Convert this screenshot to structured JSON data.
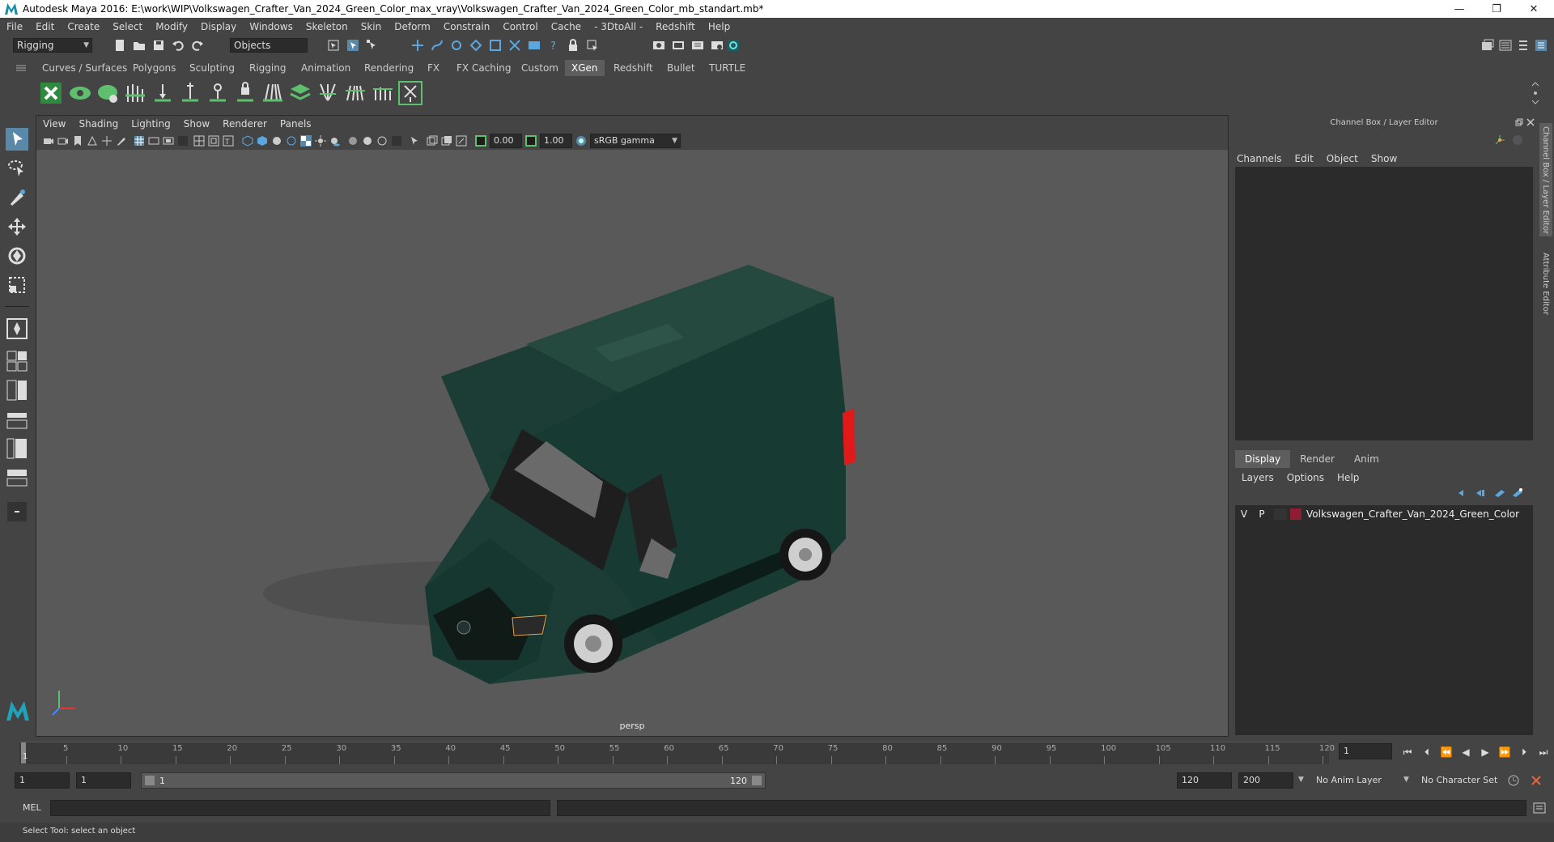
{
  "window": {
    "title": "Autodesk Maya 2016: E:\\work\\WIP\\Volkswagen_Crafter_Van_2024_Green_Color_max_vray\\Volkswagen_Crafter_Van_2024_Green_Color_mb_standart.mb*",
    "minimize": "—",
    "restore": "❐",
    "close": "✕"
  },
  "menubar": [
    "File",
    "Edit",
    "Create",
    "Select",
    "Modify",
    "Display",
    "Windows",
    "Skeleton",
    "Skin",
    "Deform",
    "Constrain",
    "Control",
    "Cache",
    "- 3DtoAll -",
    "Redshift",
    "Help"
  ],
  "toolbar": {
    "mode_menu": "Rigging",
    "selection_mode": "Objects"
  },
  "shelf_tabs": [
    "Curves / Surfaces",
    "Polygons",
    "Sculpting",
    "Rigging",
    "Animation",
    "Rendering",
    "FX",
    "FX Caching",
    "Custom",
    "XGen",
    "Redshift",
    "Bullet",
    "TURTLE"
  ],
  "shelf_active_tab": "XGen",
  "viewport": {
    "menu": [
      "View",
      "Shading",
      "Lighting",
      "Show",
      "Renderer",
      "Panels"
    ],
    "exposure": "0.00",
    "gamma": "1.00",
    "color_space": "sRGB gamma",
    "camera_label": "persp",
    "model_colors": {
      "body": "#183a32",
      "body_dark": "#0f2621",
      "glass": "#1a1a1a",
      "tyre": "#161616",
      "rim": "#cfcfcf",
      "taillight": "#e11919"
    }
  },
  "channel_box": {
    "header": "Channel Box / Layer Editor",
    "menu": [
      "Channels",
      "Edit",
      "Object",
      "Show"
    ]
  },
  "layer_editor": {
    "tabs": [
      "Display",
      "Render",
      "Anim"
    ],
    "active_tab": "Display",
    "menu": [
      "Layers",
      "Options",
      "Help"
    ],
    "layers": [
      {
        "visible": "V",
        "playback": "P",
        "name": "Volkswagen_Crafter_Van_2024_Green_Color",
        "color": "#8e1c33"
      }
    ]
  },
  "side_tabs": [
    "Channel Box / Layer Editor",
    "Attribute Editor"
  ],
  "timeline": {
    "ticks": [
      "5",
      "10",
      "15",
      "20",
      "25",
      "30",
      "35",
      "40",
      "45",
      "50",
      "55",
      "60",
      "65",
      "70",
      "75",
      "80",
      "85",
      "90",
      "95",
      "100",
      "105",
      "110",
      "115",
      "120"
    ],
    "start_label": "1",
    "current_frame": "1"
  },
  "range": {
    "start": "1",
    "playback_start": "1",
    "slider_start": "1",
    "slider_end": "120",
    "playback_end": "120",
    "end": "200",
    "anim_layer": "No Anim Layer",
    "character_set": "No Character Set"
  },
  "command_line": {
    "label": "MEL"
  },
  "status_line": "Select Tool: select an object"
}
